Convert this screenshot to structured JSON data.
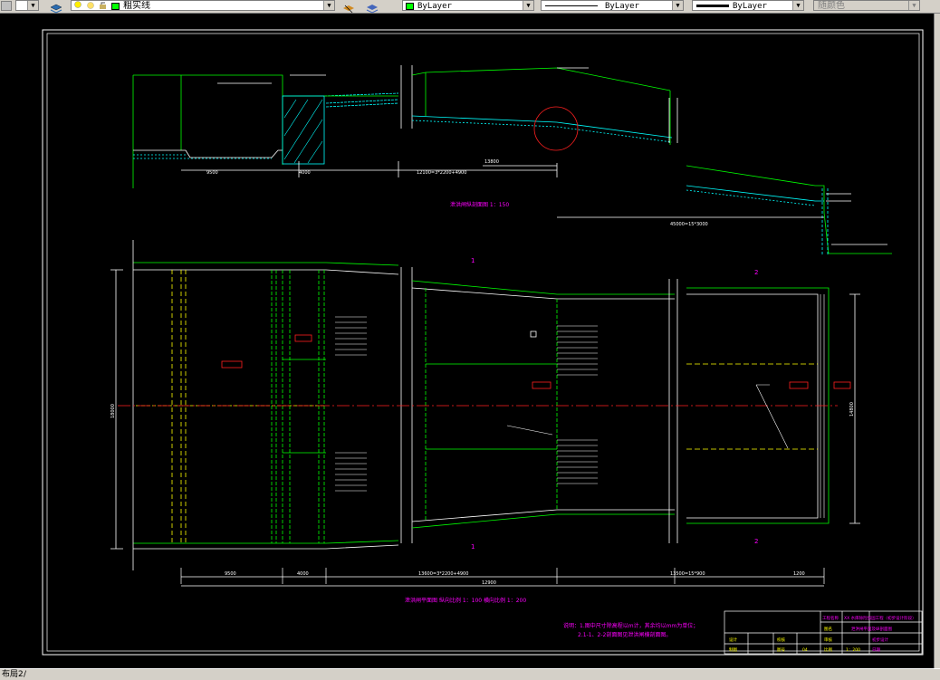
{
  "toolbar": {
    "layer_name": "粗实线",
    "color_value": "ByLayer",
    "linetype_value": "ByLayer",
    "lineweight_value": "ByLayer",
    "plotstyle_value": "随颜色",
    "colors": {
      "layer_swatch": "#00ff00",
      "color_swatch": "#00ff00"
    }
  },
  "drawing": {
    "profile_title": "泄洪闸纵剖面图 1：150",
    "plan_title": "泄洪闸平面图 纵向比例 1：100 横向比例 1：200",
    "section_1": "1",
    "section_2": "2",
    "profile_dims": {
      "d1": "9500",
      "d2": "4000",
      "d3": "12100=3*2200+4900",
      "d4": "13800",
      "d5": "45000=15*3000"
    },
    "plan_dims": {
      "d1": "9500",
      "d2": "4000",
      "d3": "13600=3*2200+4900",
      "d4": "12900",
      "d5": "13500=15*900",
      "d6": "1200",
      "left_width": "18000",
      "right_width": "14800"
    },
    "notes": {
      "line1": "说明：1.图中尺寸除高程以m计，其余均以mm为单位；",
      "line2": "2.1-1、2-2剖面图见泄洪闸横剖面图。"
    },
    "title_block": {
      "project": "工程名称",
      "project_value": "XX 水库除险加固工程（初步设计阶段）",
      "drawing_name_label": "图名",
      "drawing_name": "泄洪闸平面及纵剖面图",
      "design": "设计",
      "check": "校核",
      "drawn": "制图",
      "review": "审核",
      "drawing_no_label": "图号",
      "drawing_no": "04",
      "scale_label": "比例",
      "scale": "1：200",
      "date_label": "日期",
      "date_value": "初步设计"
    }
  },
  "statusbar": {
    "layout_tab": "布局2"
  }
}
